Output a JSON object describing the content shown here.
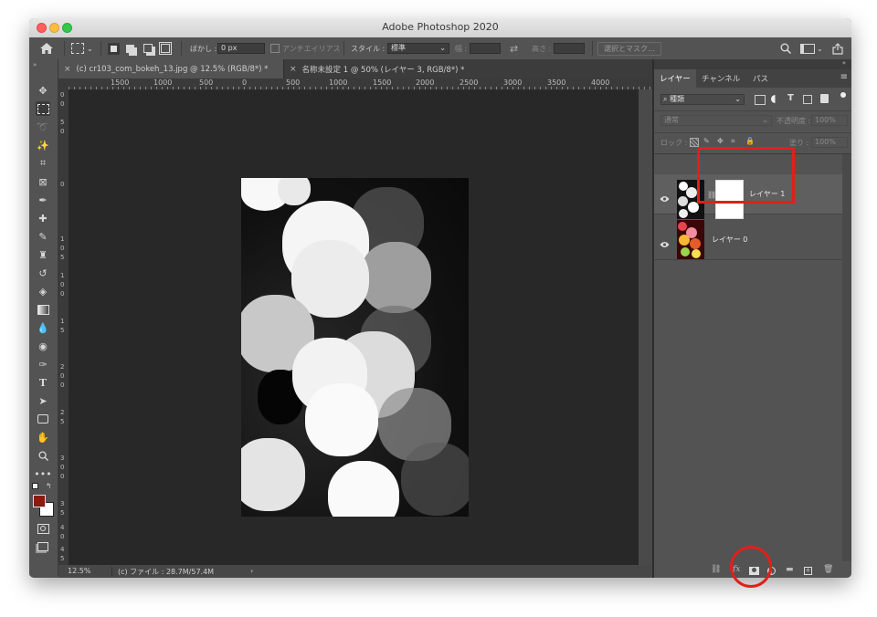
{
  "window": {
    "title": "Adobe Photoshop 2020"
  },
  "options_bar": {
    "feather_label": "ぼかし :",
    "feather_value": "0 px",
    "antialias_label": "アンチエイリアス",
    "style_label": "スタイル :",
    "style_value": "標準",
    "width_label": "幅 :",
    "height_label": "高さ :",
    "select_mask_button": "選択とマスク..."
  },
  "document_tabs": [
    {
      "label": "(c) cr103_com_bokeh_13.jpg @ 12.5% (RGB/8*) *",
      "close": "×"
    },
    {
      "label": "名称未設定 1 @ 50% (レイヤー 3, RGB/8*) *",
      "close": "×"
    }
  ],
  "ruler": {
    "h_ticks": [
      "1500",
      "1000",
      "500",
      "0",
      "500",
      "1000",
      "1500",
      "2000",
      "2500",
      "3000",
      "3500",
      "4000"
    ],
    "v_ticks": [
      "0",
      "0",
      "5",
      "0",
      "0",
      "1",
      "0",
      "5",
      "1",
      "0",
      "0",
      "1",
      "5",
      "2",
      "0",
      "0",
      "2",
      "5",
      "3",
      "0",
      "0",
      "3",
      "5",
      "4",
      "0",
      "4",
      "5"
    ]
  },
  "status_bar": {
    "zoom": "12.5%",
    "file_info": "(c) ファイル : 28.7M/57.4M",
    "arrow": "›"
  },
  "layers_panel": {
    "tabs": [
      "レイヤー",
      "チャンネル",
      "パス"
    ],
    "filter_kind": "種類",
    "blend_mode": "通常",
    "opacity_label": "不透明度 :",
    "opacity_value": "100%",
    "lock_label": "ロック :",
    "fill_label": "塗り :",
    "fill_value": "100%",
    "layers": [
      {
        "name": "レイヤー 1"
      },
      {
        "name": "レイヤー 0"
      }
    ]
  },
  "colors": {
    "foreground": "#8b1a10",
    "background": "#ffffff",
    "highlight": "#e0201a"
  }
}
